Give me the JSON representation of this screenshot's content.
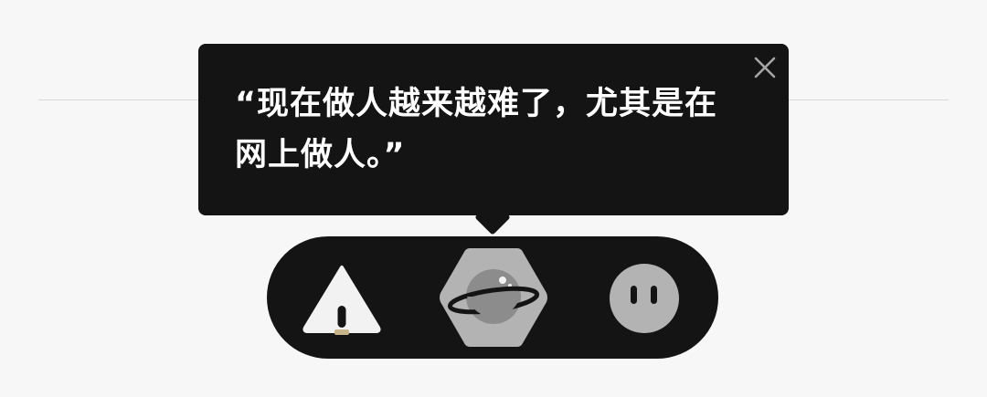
{
  "tooltip": {
    "text": "“现在做人越来越难了，尤其是在网上做人。”",
    "close_icon": "close-icon"
  },
  "dock": {
    "items": [
      {
        "id": "warning",
        "icon": "warning-triangle-icon",
        "selected": false
      },
      {
        "id": "planet",
        "icon": "planet-icon",
        "selected": true
      },
      {
        "id": "face",
        "icon": "face-icon",
        "selected": false
      }
    ]
  },
  "colors": {
    "background": "#f7f7f7",
    "panel": "#141414",
    "tooltip_text": "#ffffff",
    "selected_hexagon": "#b3b3b3",
    "icon_light": "#f2f2f2",
    "icon_grey": "#8c8c8c"
  }
}
